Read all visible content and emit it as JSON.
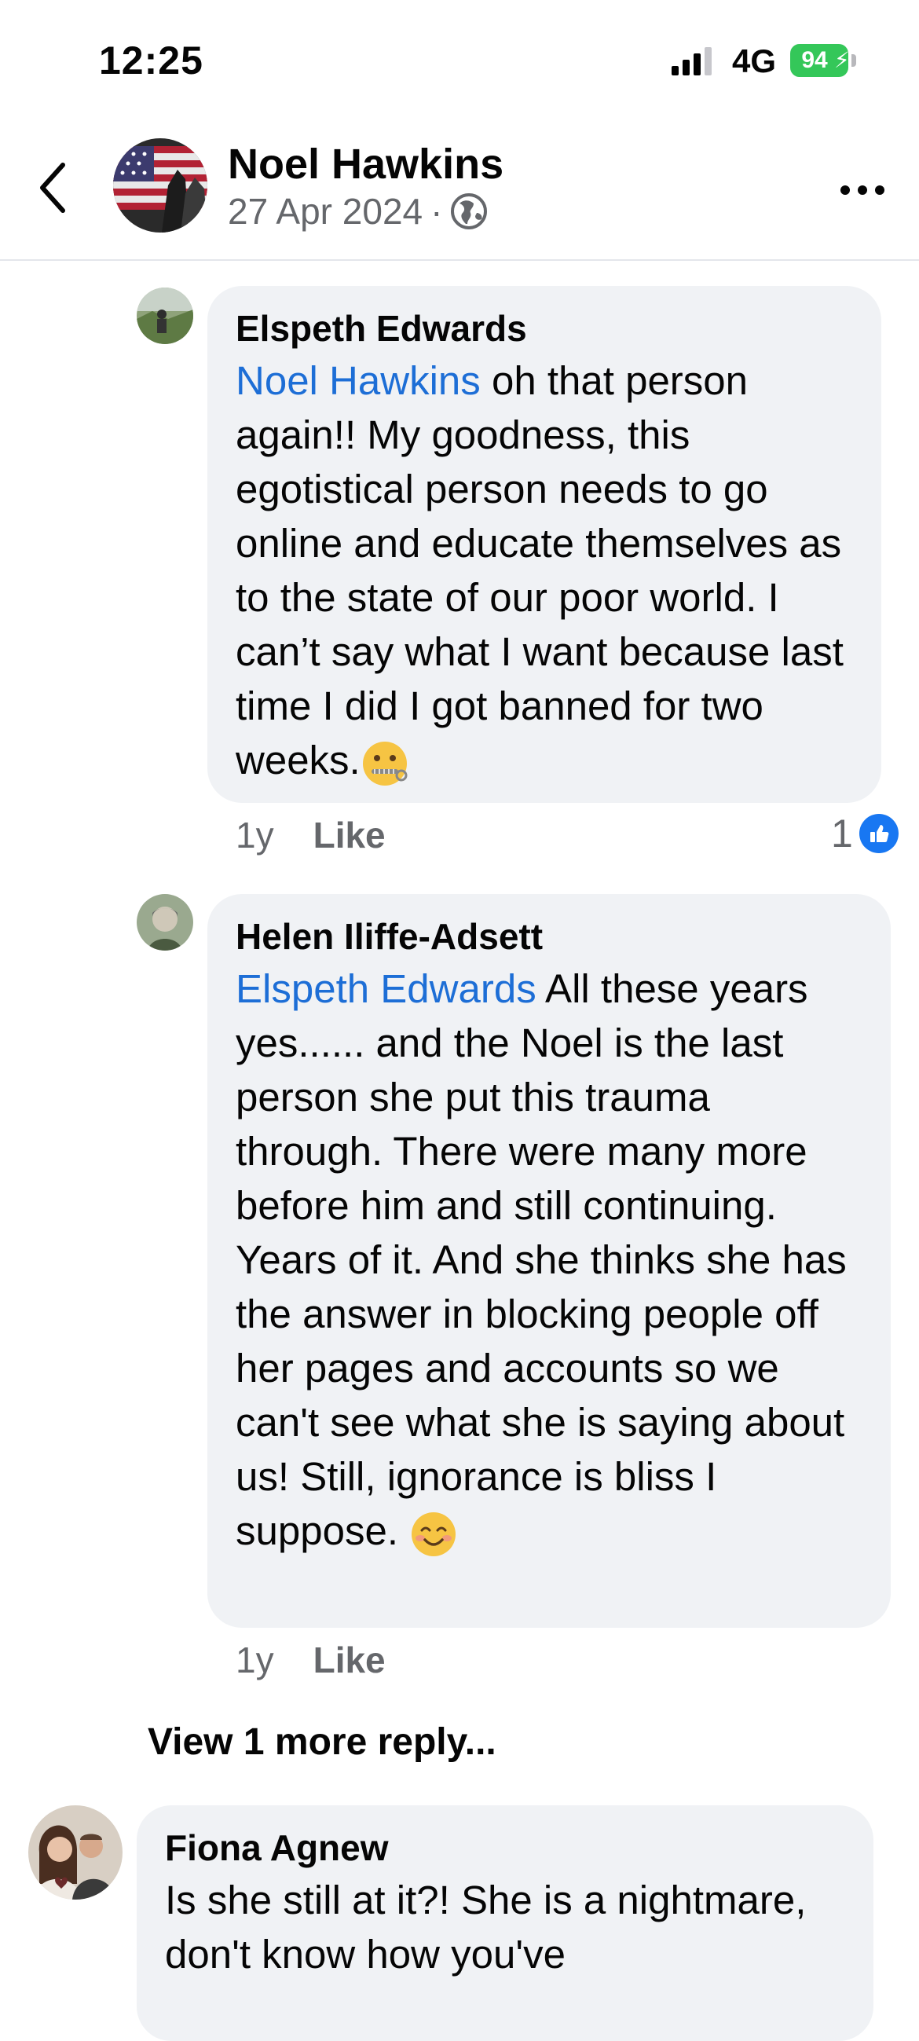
{
  "status_bar": {
    "time": "12:25",
    "network": "4G",
    "battery": "94"
  },
  "header": {
    "name": "Noel Hawkins",
    "date": "27 Apr 2024",
    "separator": "·",
    "icons": [
      "back-chevron-icon",
      "globe-icon",
      "more-icon"
    ]
  },
  "comments": [
    {
      "author": "Elspeth Edwards",
      "mention": "Noel Hawkins",
      "text": " oh that person again!! My goodness, this egotistical person needs to go online and educate themselves as to the state of our poor world. I can’t say what I want because last time I did I got banned for two weeks.",
      "emoji": "zipper-mouth-face",
      "age": "1y",
      "like_label": "Like",
      "reaction_count": "1"
    },
    {
      "author": "Helen Iliffe-Adsett",
      "mention": "Elspeth Edwards",
      "text": " All these years yes...... and the Noel is the last person she put this trauma through. There were many more before him and still continuing.  Years of it. And she thinks she has the answer in blocking people off her pages and accounts so we can't see what she is saying about us! Still, ignorance is bliss I suppose. ",
      "emoji": "smiling-face",
      "age": "1y",
      "like_label": "Like"
    }
  ],
  "view_more": "View 1 more reply...",
  "bottom_comment": {
    "author": "Fiona Agnew",
    "text": "Is she still at it?! She is a nightmare, don't know how you've"
  },
  "colors": {
    "mention": "#1d6ed6",
    "bubble": "#f0f2f5",
    "meta": "#65676b",
    "like_badge": "#1877f2",
    "battery": "#34c759"
  }
}
